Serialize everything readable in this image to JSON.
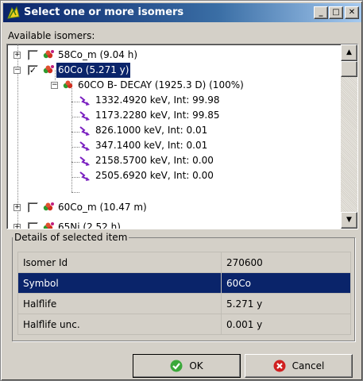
{
  "window": {
    "title": "Select one or more isomers",
    "icon": "app-leaf-icon",
    "controls": {
      "minimize": "_",
      "maximize": "□",
      "close": "✕"
    }
  },
  "available_label": "Available isomers:",
  "tree": {
    "rows": [
      {
        "text": "58Co_m (9.04 h)",
        "expander": "+",
        "checked": false
      },
      {
        "text": "60Co (5.271 y)",
        "expander": "−",
        "checked": true,
        "selected": true
      },
      {
        "text": "60CO B- DECAY (1925.3 D) (100%)",
        "expander": "−"
      },
      {
        "text": "1332.4920 keV, Int: 99.98"
      },
      {
        "text": "1173.2280 keV, Int: 99.85"
      },
      {
        "text": "826.1000 keV, Int: 0.01"
      },
      {
        "text": "347.1400 keV, Int: 0.01"
      },
      {
        "text": "2158.5700 keV, Int: 0.00"
      },
      {
        "text": "2505.6920 keV, Int: 0.00"
      },
      {
        "text": "60Co_m (10.47 m)",
        "expander": "+",
        "checked": false
      },
      {
        "text": "65Ni (2.52 h)",
        "expander": "+",
        "checked": false
      }
    ]
  },
  "details": {
    "group_label": "Details of selected item",
    "rows": [
      {
        "key": "Isomer Id",
        "value": "270600"
      },
      {
        "key": "Symbol",
        "value": "60Co",
        "selected": true
      },
      {
        "key": "Halflife",
        "value": "5.271 y"
      },
      {
        "key": "Halflife unc.",
        "value": "0.001 y"
      }
    ]
  },
  "buttons": {
    "ok": "OK",
    "cancel": "Cancel"
  },
  "colors": {
    "selection": "#0a246a",
    "title_start": "#0a246a",
    "title_end": "#a6caf0",
    "face": "#d4d0c8"
  }
}
